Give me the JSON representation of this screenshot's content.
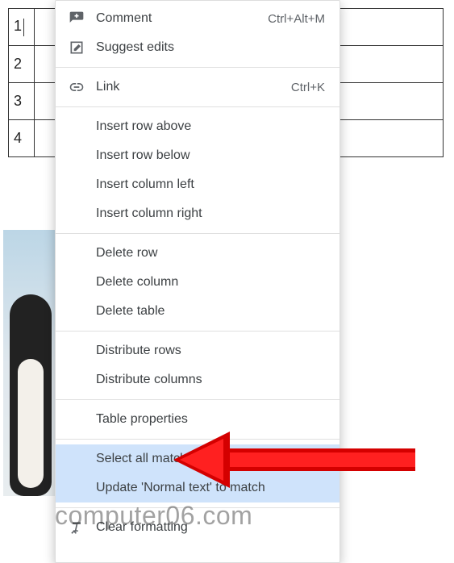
{
  "table": {
    "rows": [
      "1",
      "2",
      "3",
      "4"
    ]
  },
  "menu": {
    "comment": {
      "label": "Comment",
      "shortcut": "Ctrl+Alt+M"
    },
    "suggest": {
      "label": "Suggest edits"
    },
    "link": {
      "label": "Link",
      "shortcut": "Ctrl+K"
    },
    "insert_row_above": "Insert row above",
    "insert_row_below": "Insert row below",
    "insert_col_left": "Insert column left",
    "insert_col_right": "Insert column right",
    "delete_row": "Delete row",
    "delete_col": "Delete column",
    "delete_table": "Delete table",
    "distribute_rows": "Distribute rows",
    "distribute_cols": "Distribute columns",
    "table_properties": "Table properties",
    "select_matching": "Select all matching text",
    "update_normal": "Update 'Normal text' to match",
    "clear_formatting": "Clear formatting"
  },
  "watermark": "computer06.com"
}
